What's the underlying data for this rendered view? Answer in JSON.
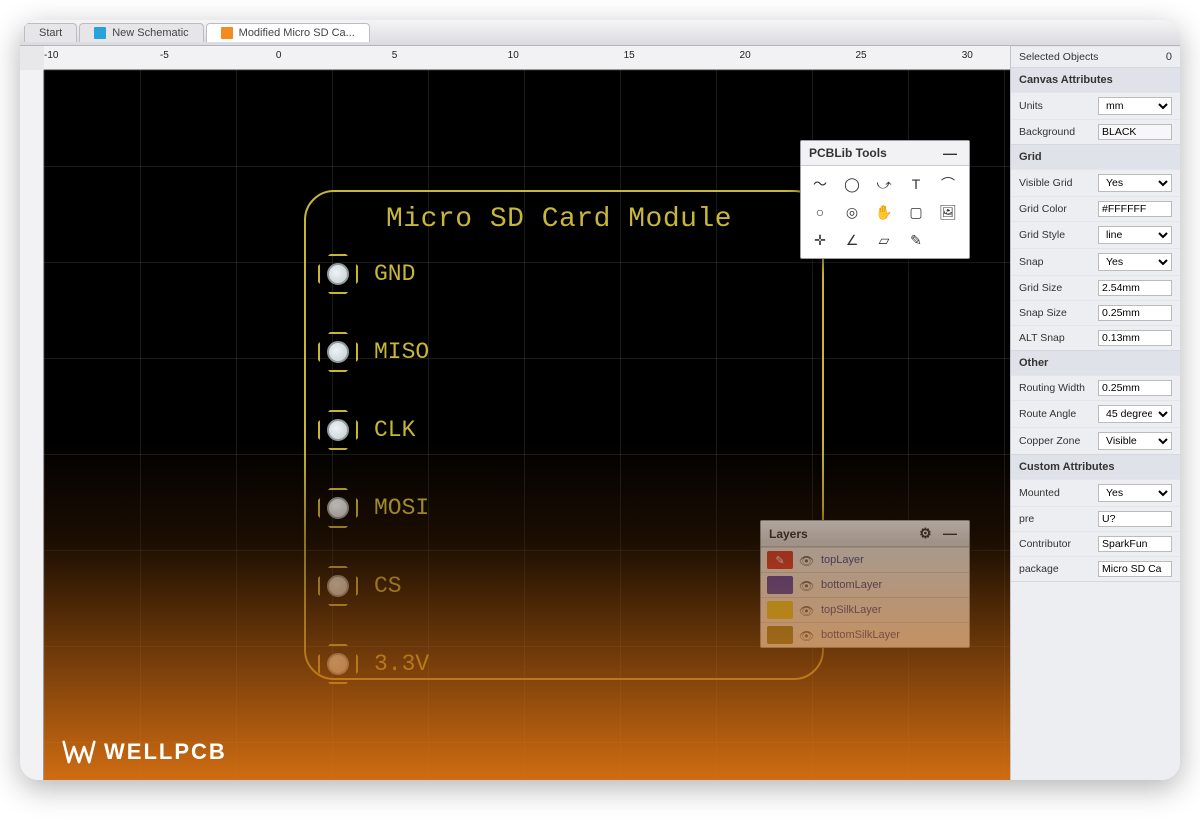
{
  "tabs": {
    "start": "Start",
    "new_schematic": "New Schematic",
    "current": "Modified Micro SD Ca..."
  },
  "ruler": {
    "h": [
      "-10",
      "-5",
      "0",
      "5",
      "10",
      "15",
      "20",
      "25",
      "30"
    ]
  },
  "board": {
    "title": "Micro SD Card Module",
    "pins": [
      "GND",
      "MISO",
      "CLK",
      "MOSI",
      "CS",
      "3.3V"
    ]
  },
  "toolbox": {
    "title": "PCBLib Tools",
    "tools": [
      "trace-icon",
      "circle-o-icon",
      "arc-icon",
      "text-icon",
      "curve-icon",
      "ellipse-icon",
      "ring-icon",
      "hand-icon",
      "rect-cross-icon",
      "image-icon",
      "cross-icon",
      "angle-icon",
      "poly-icon",
      "pen-icon"
    ]
  },
  "layers": {
    "title": "Layers",
    "items": [
      {
        "name": "topLayer",
        "color": "#e33a2f",
        "active": true
      },
      {
        "name": "bottomLayer",
        "color": "#4a3fbd",
        "active": false
      },
      {
        "name": "topSilkLayer",
        "color": "#efd92c",
        "active": false
      },
      {
        "name": "bottomSilkLayer",
        "color": "#9a8b2b",
        "active": false
      }
    ]
  },
  "sidebar": {
    "selected": {
      "label": "Selected Objects",
      "value": "0"
    },
    "canvas_attrs": {
      "section": "Canvas Attributes",
      "units": {
        "label": "Units",
        "value": "mm"
      },
      "background": {
        "label": "Background",
        "value": "BLACK"
      }
    },
    "grid": {
      "section": "Grid",
      "visible": {
        "label": "Visible Grid",
        "value": "Yes"
      },
      "color": {
        "label": "Grid Color",
        "value": "#FFFFFF"
      },
      "style": {
        "label": "Grid Style",
        "value": "line"
      },
      "snap": {
        "label": "Snap",
        "value": "Yes"
      },
      "size": {
        "label": "Grid Size",
        "value": "2.54mm"
      },
      "snap_size": {
        "label": "Snap Size",
        "value": "0.25mm"
      },
      "alt_snap": {
        "label": "ALT Snap",
        "value": "0.13mm"
      }
    },
    "other": {
      "section": "Other",
      "routing_width": {
        "label": "Routing Width",
        "value": "0.25mm"
      },
      "route_angle": {
        "label": "Route Angle",
        "value": "45 degree"
      },
      "copper_zone": {
        "label": "Copper Zone",
        "value": "Visible"
      }
    },
    "custom": {
      "section": "Custom Attributes",
      "mounted": {
        "label": "Mounted",
        "value": "Yes"
      },
      "pre": {
        "label": "pre",
        "value": "U?"
      },
      "contributor": {
        "label": "Contributor",
        "value": "SparkFun"
      },
      "package": {
        "label": "package",
        "value": "Micro SD Ca"
      }
    }
  },
  "brand": "WELLPCB"
}
